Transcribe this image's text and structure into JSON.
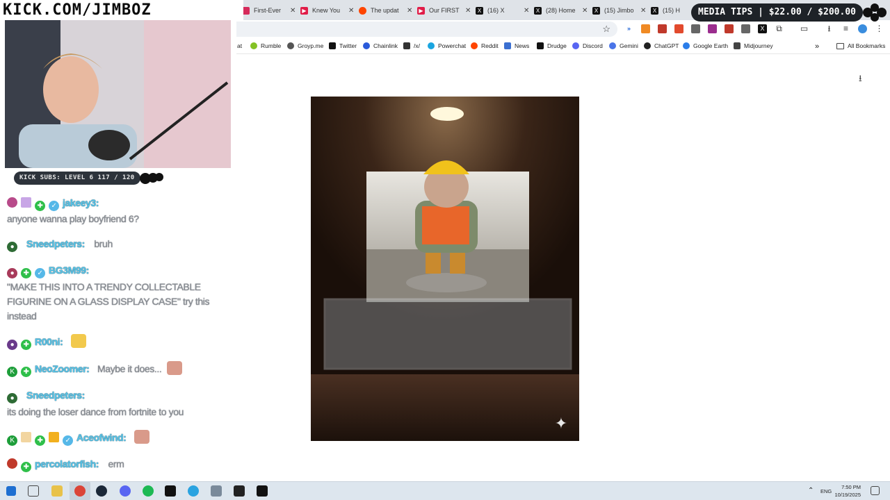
{
  "overlay": {
    "brand": "KICK.COM/JIMBOZ",
    "kick_subs": "KICK SUBS: LEVEL 6 117 / 120",
    "media_tips": "MEDIA TIPS | $22.00 / $200.00"
  },
  "browser": {
    "tabs": [
      {
        "title": "First-Ever",
        "color": "#d62b5b",
        "icon": "kick-icon"
      },
      {
        "title": "Knew You",
        "color": "#e11d48",
        "icon": "youtube-icon"
      },
      {
        "title": "The updat",
        "color": "#ff4500",
        "icon": "reddit-icon"
      },
      {
        "title": "Our FIRST",
        "color": "#e11d48",
        "icon": "youtube-icon"
      },
      {
        "title": "(16) X",
        "color": "#111111",
        "icon": "x-icon"
      },
      {
        "title": "(28) Home",
        "color": "#111111",
        "icon": "x-icon"
      },
      {
        "title": "(15) Jimbo",
        "color": "#111111",
        "icon": "x-icon"
      },
      {
        "title": "(15) H",
        "color": "#111111",
        "icon": "x-icon"
      }
    ],
    "bookmarks": [
      {
        "label": "at",
        "color": ""
      },
      {
        "label": "Rumble",
        "color": "#84c225"
      },
      {
        "label": "Groyp.me",
        "color": "#555555"
      },
      {
        "label": "Twitter",
        "color": "#111111"
      },
      {
        "label": "Chainlink",
        "color": "#2a5ada"
      },
      {
        "label": "/x/",
        "color": "#333333"
      },
      {
        "label": "Powerchat",
        "color": "#1aa5e0"
      },
      {
        "label": "Reddit",
        "color": "#ff4500"
      },
      {
        "label": "News",
        "color": "#3b6fd1"
      },
      {
        "label": "Drudge",
        "color": "#111111"
      },
      {
        "label": "Discord",
        "color": "#5865f2"
      },
      {
        "label": "Gemini",
        "color": "#4a74e8"
      },
      {
        "label": "ChatGPT",
        "color": "#222222"
      },
      {
        "label": "Google Earth",
        "color": "#2b7de9"
      },
      {
        "label": "Midjourney",
        "color": "#444444"
      }
    ],
    "all_bookmarks": "All Bookmarks"
  },
  "chat": [
    {
      "user": "jakeey3:",
      "text": "anyone wanna play boyfriend 6?"
    },
    {
      "user": "Sneedpeters:",
      "text": "bruh"
    },
    {
      "user": "BG3M99:",
      "text": "\"MAKE THIS INTO A TRENDY COLLECTABLE FIGURINE ON A GLASS DISPLAY CASE\" try this instead"
    },
    {
      "user": "R00ni:",
      "text": ""
    },
    {
      "user": "NeoZoomer:",
      "text": "Maybe it does..."
    },
    {
      "user": "Sneedpeters:",
      "text": "its doing the loser dance from fortnite to you"
    },
    {
      "user": "Aceofwind:",
      "text": ""
    },
    {
      "user": "percolatorfish:",
      "text": "erm"
    }
  ],
  "taskbar": {
    "language": "ENG",
    "time": "7:50 PM",
    "date": "10/19/2025"
  }
}
